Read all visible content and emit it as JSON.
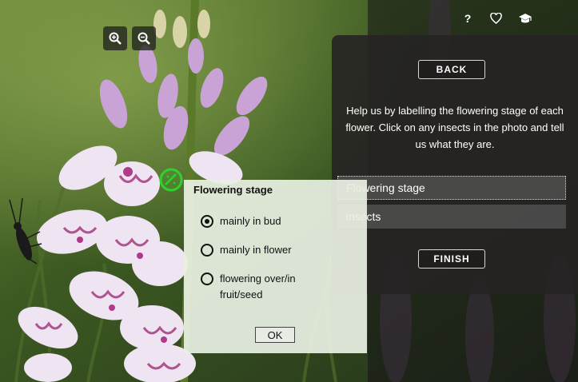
{
  "toolbar": {
    "zoom_in_icon": "zoom-in-icon",
    "zoom_out_icon": "zoom-out-icon",
    "help_label": "?",
    "favorite_icon": "heart-icon",
    "education_icon": "graduation-cap-icon"
  },
  "panel": {
    "back_label": "BACK",
    "help_text": "Help us by labelling the flowering stage of each flower. Click on any insects in the photo and tell us what they are.",
    "tasks": [
      {
        "label": "Flowering stage"
      },
      {
        "label": "Insects"
      }
    ],
    "finish_label": "FINISH"
  },
  "popup": {
    "title": "Flowering stage",
    "options": [
      {
        "label": "mainly in bud",
        "selected": true
      },
      {
        "label": "mainly in flower",
        "selected": false
      },
      {
        "label": "flowering over/in fruit/seed",
        "selected": false
      }
    ],
    "ok_label": "OK"
  },
  "colors": {
    "marker": "#2fd12f",
    "panel_bg": "#262424",
    "popup_bg": "#e8f0e2"
  }
}
